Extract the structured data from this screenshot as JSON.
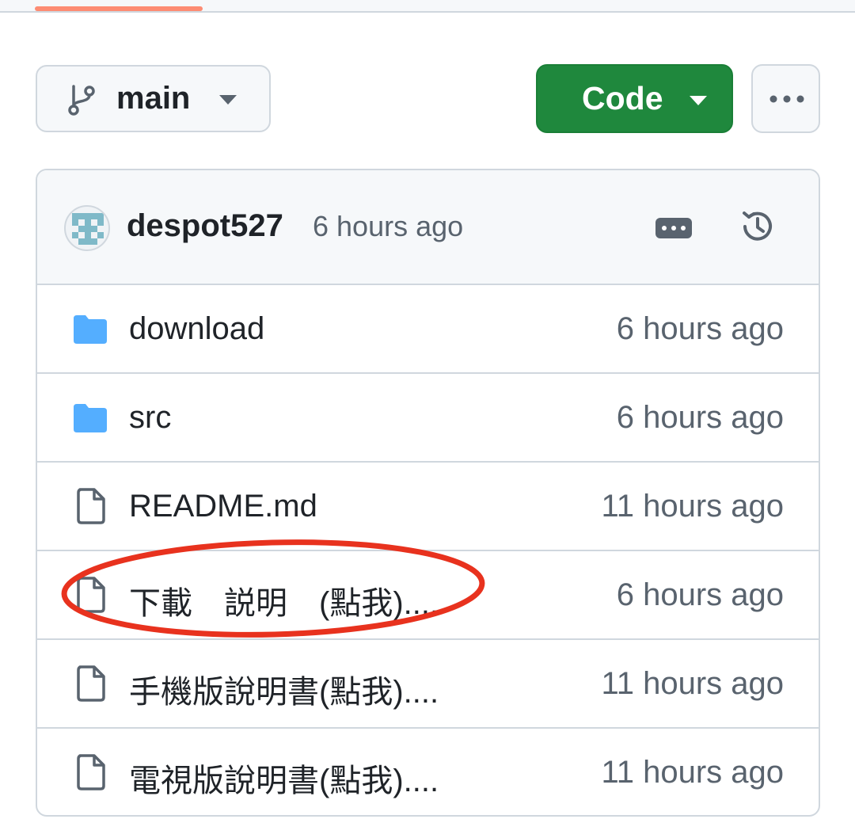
{
  "branch": {
    "label": "main",
    "icon": "git-branch-icon"
  },
  "code_button": {
    "label": "Code",
    "color": "#1f883d"
  },
  "more_button": {
    "icon": "kebab-horizontal-icon"
  },
  "latest_commit": {
    "author": "despot527",
    "time": "6 hours ago"
  },
  "files": [
    {
      "name": "download",
      "time": "6 hours ago",
      "type": "folder"
    },
    {
      "name": "src",
      "time": "6 hours ago",
      "type": "folder"
    },
    {
      "name": "README.md",
      "time": "11 hours ago",
      "type": "file"
    },
    {
      "name": "下載　説明　(點我)....",
      "time": "6 hours ago",
      "type": "file"
    },
    {
      "name": "手機版說明書(點我)....",
      "time": "11 hours ago",
      "type": "file"
    },
    {
      "name": "電視版說明書(點我)....",
      "time": "11 hours ago",
      "type": "file"
    }
  ],
  "colors": {
    "folder": "#54aeff",
    "annotation": "#e8321e",
    "tab_underline": "#fd8c73"
  }
}
